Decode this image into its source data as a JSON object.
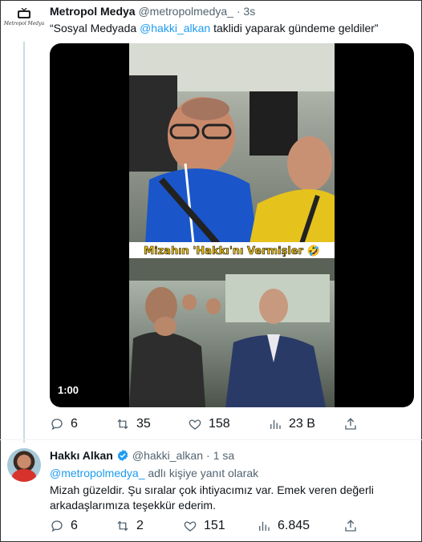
{
  "tweet": {
    "author_name": "Metropol Medya",
    "author_handle": "@metropolmedya_",
    "separator": "·",
    "time": "3s",
    "logo_text": "Metropol Medya",
    "text_before": "“Sosyal Medyada ",
    "text_mention": "@hakki_alkan",
    "text_after": " taklidi yaparak gündeme geldiler”",
    "media": {
      "caption": "Mizahın 'Hakkı'nı Vermişler 🤣",
      "duration": "1:00"
    },
    "stats": {
      "replies": "6",
      "retweets": "35",
      "likes": "158",
      "views": "23 B"
    }
  },
  "reply": {
    "author_name": "Hakkı Alkan",
    "author_handle": "@hakki_alkan",
    "separator": "·",
    "time": "1 sa",
    "reply_to_mention": "@metropolmedya_",
    "reply_to_suffix": " adlı kişiye yanıt olarak",
    "text": "Mizah güzeldir. Şu sıralar çok ihtiyacımız var. Emek veren değerli arkadaşlarımıza teşekkür ederim.",
    "stats": {
      "replies": "6",
      "retweets": "2",
      "likes": "151",
      "views": "6.845"
    }
  },
  "colors": {
    "accent": "#1d9bf0",
    "muted": "#536471",
    "caption": "#f2c200"
  },
  "icons": [
    "reply-icon",
    "retweet-icon",
    "like-icon",
    "views-icon",
    "share-icon",
    "verified-icon",
    "tv-icon"
  ]
}
